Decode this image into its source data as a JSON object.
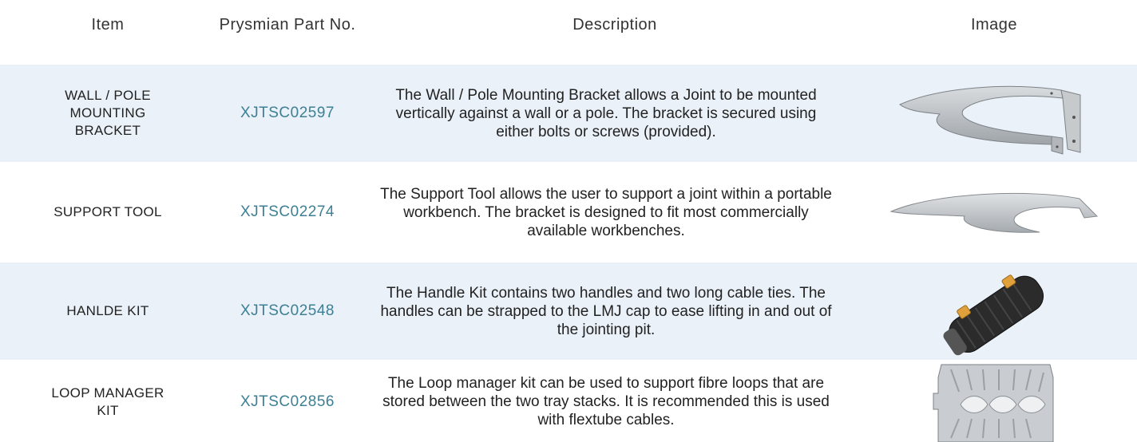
{
  "headers": {
    "item": "Item",
    "part": "Prysmian Part No.",
    "description": "Description",
    "image": "Image"
  },
  "rows": [
    {
      "item": "WALL / POLE MOUNTING BRACKET",
      "part": "XJTSC02597",
      "description": "The Wall / Pole Mounting Bracket allows a Joint to be mounted vertically against a wall or a pole. The bracket is secured using either bolts or screws (provided).",
      "image": "wall-pole-bracket-icon"
    },
    {
      "item": "SUPPORT TOOL",
      "part": "XJTSC02274",
      "description": "The Support Tool allows the user to support a joint within a portable workbench. The bracket is designed to fit most commercially available workbenches.",
      "image": "support-tool-icon"
    },
    {
      "item": "HANLDE KIT",
      "part": "XJTSC02548",
      "description": "The Handle Kit contains two handles and two long cable ties.  The handles can be strapped to the LMJ cap to ease lifting in and out of the jointing pit.",
      "image": "handle-kit-icon"
    },
    {
      "item": "LOOP MANAGER KIT",
      "part": "XJTSC02856",
      "description": "The Loop manager kit can be used to support fibre loops that are stored between the two tray stacks. It is recommended this is used with flextube cables.",
      "image": "loop-manager-kit-icon"
    }
  ],
  "colors": {
    "row_shade": "#eaf1f8",
    "part_link": "#3d7f94"
  }
}
